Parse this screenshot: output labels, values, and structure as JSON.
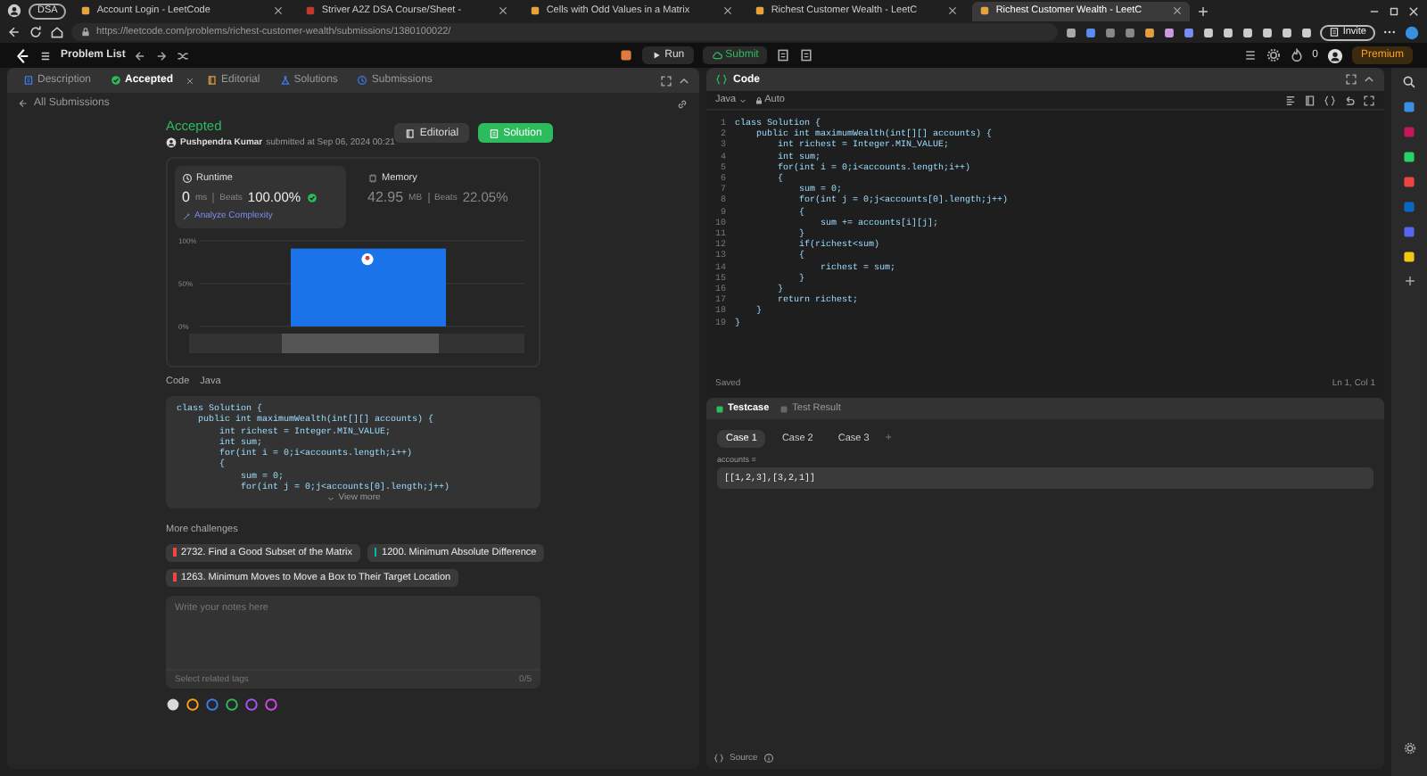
{
  "browser": {
    "profile": "DSA",
    "tabs": [
      {
        "title": "Account Login - LeetCode",
        "selected": false
      },
      {
        "title": "Striver A2Z DSA Course/Sheet -",
        "selected": false
      },
      {
        "title": "Cells with Odd Values in a Matrix",
        "selected": false
      },
      {
        "title": "Richest Customer Wealth - LeetC",
        "selected": false
      },
      {
        "title": "Richest Customer Wealth - LeetC",
        "selected": true
      }
    ],
    "address": "https://leetcode.com/problems/richest-customer-wealth/submissions/1380100022/",
    "invite": "Invite"
  },
  "topbar": {
    "problem_list": "Problem List",
    "run": "Run",
    "submit": "Submit",
    "streak": "0",
    "premium": "Premium"
  },
  "left_panel": {
    "tabs": [
      {
        "label": "Description",
        "selected": false
      },
      {
        "label": "Accepted",
        "selected": true
      },
      {
        "label": "Editorial",
        "selected": false
      },
      {
        "label": "Solutions",
        "selected": false
      },
      {
        "label": "Submissions",
        "selected": false
      }
    ],
    "back_link": "All Submissions",
    "status": "Accepted",
    "author": "Pushpendra Kumar",
    "submitted": "submitted at Sep 06, 2024 00:21",
    "editorial": "Editorial",
    "solution": "Solution",
    "runtime": {
      "title": "Runtime",
      "value": "0",
      "unit": "ms",
      "beats_label": "Beats",
      "beats": "100.00%",
      "analyze": "Analyze Complexity"
    },
    "memory": {
      "title": "Memory",
      "value": "42.95",
      "unit": "MB",
      "beats_label": "Beats",
      "beats": "22.05%"
    },
    "chart_data": {
      "type": "bar",
      "values": [
        91
      ],
      "ylim": [
        0,
        100
      ],
      "yticks": [
        {
          "value": 0,
          "label": "0%"
        },
        {
          "value": 50,
          "label": "50%"
        },
        {
          "value": 100,
          "label": "100%"
        }
      ]
    },
    "code_tabs": [
      "Code",
      "Java"
    ],
    "code": [
      "class Solution {",
      "    public int maximumWealth(int[][] accounts) {",
      "        int richest = Integer.MIN_VALUE;",
      "        int sum;",
      "        for(int i = 0;i<accounts.length;i++)",
      "        {",
      "            sum = 0;",
      "            for(int j = 0;j<accounts[0].length;j++)"
    ],
    "view_more": "View more",
    "more_challenges": "More challenges",
    "challenges": [
      {
        "title": "2732. Find a Good Subset of the Matrix",
        "color": "#ef4743"
      },
      {
        "title": "1200. Minimum Absolute Difference",
        "color": "#00b8a3"
      },
      {
        "title": "1263. Minimum Moves to Move a Box to Their Target Location",
        "color": "#ef4743"
      }
    ],
    "notes": {
      "placeholder": "Write your notes here",
      "tags_placeholder": "Select related tags",
      "count": "0/5"
    },
    "note_colors": [
      {
        "color": "#d9d9d9",
        "selected": true
      },
      {
        "color": "#ffa116",
        "selected": false
      },
      {
        "color": "#3c7df0",
        "selected": false
      },
      {
        "color": "#2cbb5d",
        "selected": false
      },
      {
        "color": "#a855f7",
        "selected": false
      },
      {
        "color": "#d946ef",
        "selected": false
      }
    ]
  },
  "code_panel": {
    "title": "Code",
    "language": "Java",
    "mode": "Auto",
    "lines": [
      "class Solution {",
      "    public int maximumWealth(int[][] accounts) {",
      "        int richest = Integer.MIN_VALUE;",
      "        int sum;",
      "        for(int i = 0;i<accounts.length;i++)",
      "        {",
      "            sum = 0;",
      "            for(int j = 0;j<accounts[0].length;j++)",
      "            {",
      "                sum += accounts[i][j];",
      "            }",
      "            if(richest<sum)",
      "            {",
      "                richest = sum;",
      "            }",
      "        }",
      "        return richest;",
      "    }",
      "}"
    ],
    "line_numbers": [
      "1",
      "2",
      "3",
      "4",
      "5",
      "6",
      "7",
      "8",
      "9",
      "10",
      "11",
      "12",
      "13",
      "14",
      "15",
      "16",
      "17",
      "18",
      "19"
    ],
    "saved": "Saved",
    "cursor": "Ln 1, Col 1"
  },
  "test_panel": {
    "tabs": [
      {
        "label": "Testcase",
        "selected": true
      },
      {
        "label": "Test Result",
        "selected": false
      }
    ],
    "cases": [
      {
        "label": "Case 1",
        "selected": true
      },
      {
        "label": "Case 2",
        "selected": false
      },
      {
        "label": "Case 3",
        "selected": false
      }
    ],
    "add": "+",
    "param": "accounts =",
    "value": "[[1,2,3],[3,2,1]]",
    "source": "Source"
  }
}
